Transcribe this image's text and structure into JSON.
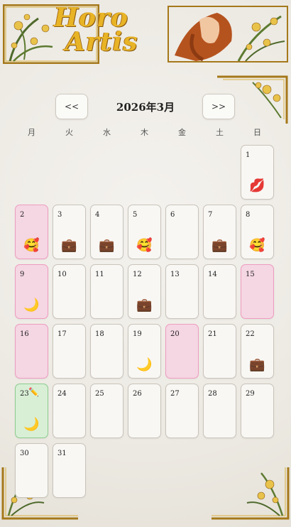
{
  "app": {
    "logo_line1": "Horo",
    "logo_line2": "Artis"
  },
  "nav": {
    "prev_label": "<<",
    "next_label": ">>",
    "month_title": "2026年3月"
  },
  "weekdays": [
    "月",
    "火",
    "水",
    "木",
    "金",
    "土",
    "日"
  ],
  "icons": {
    "lips": "💋",
    "blush": "🥰",
    "briefcase": "💼",
    "moon": "🌙",
    "pencil": "✏️"
  },
  "days": [
    {
      "day": "1",
      "event": "💋"
    },
    {
      "day": "2",
      "event": "🥰"
    },
    {
      "day": "3",
      "event": "💼"
    },
    {
      "day": "4",
      "event": "💼"
    },
    {
      "day": "5",
      "event": "🥰"
    },
    {
      "day": "6",
      "event": ""
    },
    {
      "day": "7",
      "event": "💼"
    },
    {
      "day": "8",
      "event": "🥰"
    },
    {
      "day": "9",
      "event": "🌙"
    },
    {
      "day": "10",
      "event": ""
    },
    {
      "day": "11",
      "event": ""
    },
    {
      "day": "12",
      "event": "💼"
    },
    {
      "day": "13",
      "event": ""
    },
    {
      "day": "14",
      "event": ""
    },
    {
      "day": "15",
      "event": ""
    },
    {
      "day": "16",
      "event": ""
    },
    {
      "day": "17",
      "event": ""
    },
    {
      "day": "18",
      "event": ""
    },
    {
      "day": "19",
      "event": "🌙"
    },
    {
      "day": "20",
      "event": ""
    },
    {
      "day": "21",
      "event": ""
    },
    {
      "day": "22",
      "event": "💼"
    },
    {
      "day": "23",
      "event": "🌙",
      "marker": "✏️"
    },
    {
      "day": "24",
      "event": ""
    },
    {
      "day": "25",
      "event": ""
    },
    {
      "day": "26",
      "event": ""
    },
    {
      "day": "27",
      "event": ""
    },
    {
      "day": "28",
      "event": ""
    },
    {
      "day": "29",
      "event": ""
    },
    {
      "day": "30",
      "event": ""
    },
    {
      "day": "31",
      "event": ""
    }
  ],
  "colors": {
    "pink_cell": "#f5d6e3",
    "green_cell": "#d8efd6",
    "gold": "#e8b426"
  }
}
